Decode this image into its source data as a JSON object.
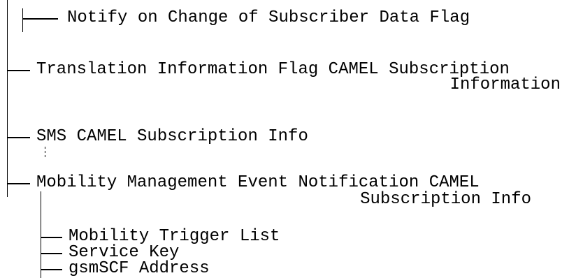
{
  "tree": {
    "nodes": [
      {
        "key": "notify",
        "label": "Notify on Change of Subscriber Data Flag"
      },
      {
        "key": "translation",
        "label_line1": "Translation Information Flag CAMEL Subscription",
        "label_line2": "Information"
      },
      {
        "key": "sms",
        "label": "SMS CAMEL Subscription Info"
      },
      {
        "key": "mobility",
        "label_line1": "Mobility Management Event Notification CAMEL",
        "label_line2": "Subscription Info"
      },
      {
        "key": "trigger-list",
        "label": "Mobility Trigger List"
      },
      {
        "key": "service-key",
        "label": "Service Key"
      },
      {
        "key": "gsmscf",
        "label": "gsmSCF Address"
      }
    ]
  }
}
